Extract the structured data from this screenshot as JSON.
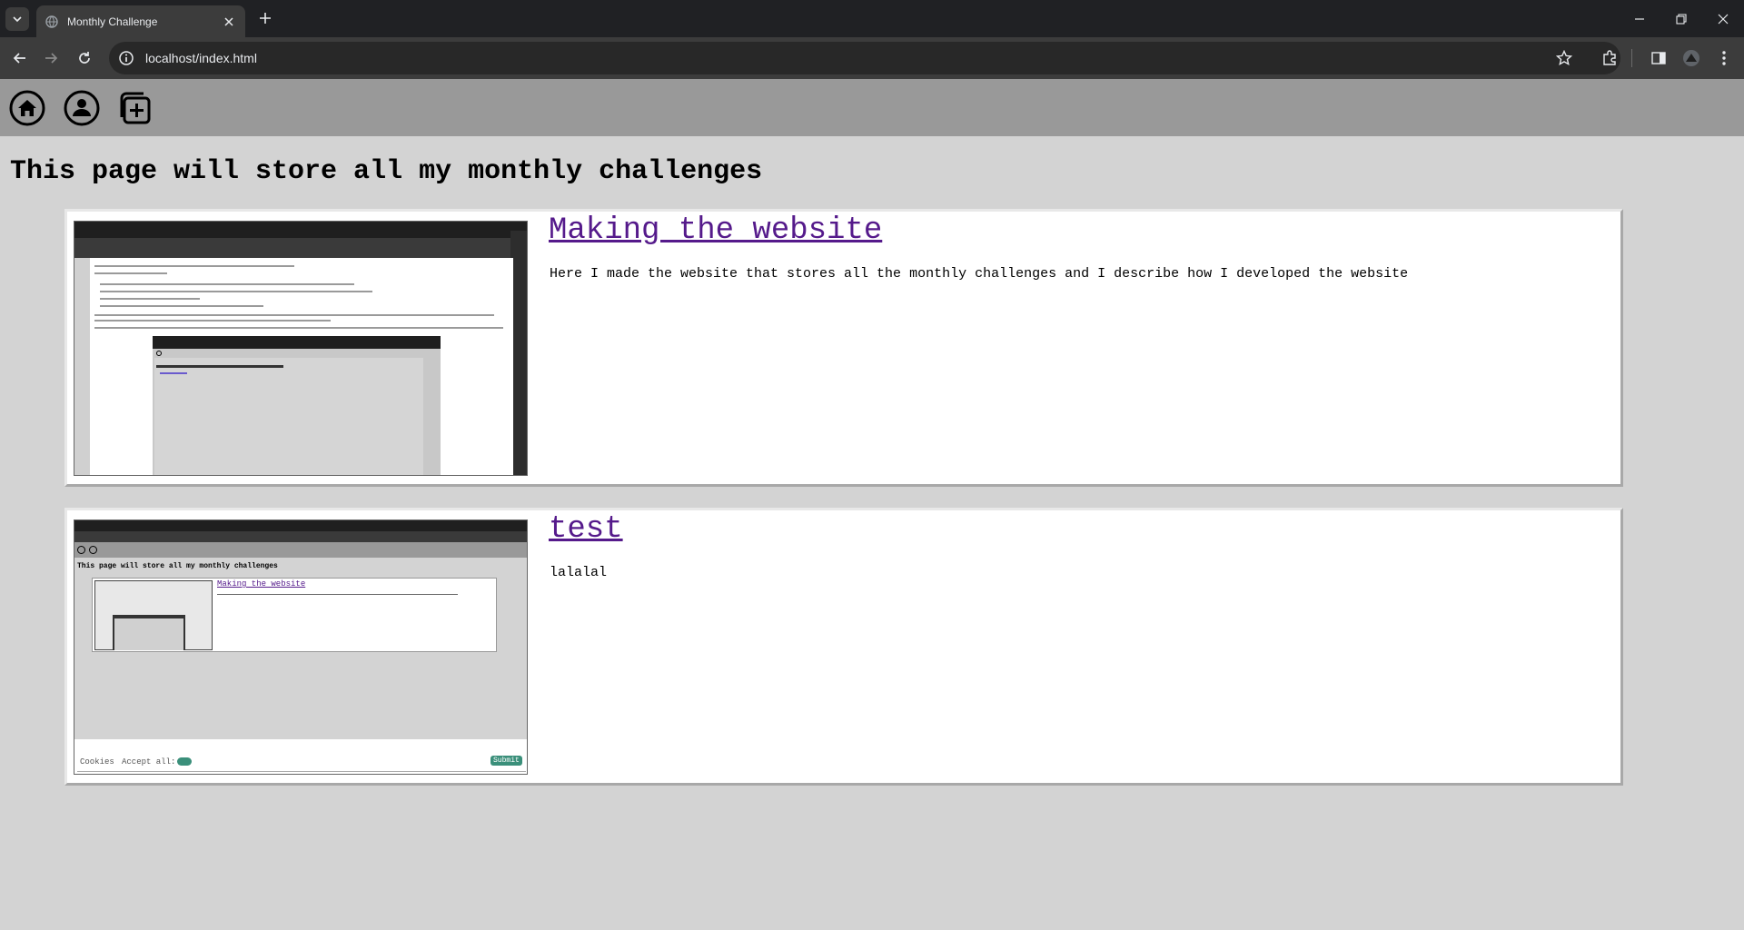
{
  "browser": {
    "tab_title": "Monthly Challenge",
    "url": "localhost/index.html"
  },
  "page": {
    "heading": "This page will store all my monthly challenges",
    "nav_icons": [
      "home-icon",
      "user-icon",
      "add-post-icon"
    ]
  },
  "challenges": [
    {
      "title": "Making the website",
      "description": "Here I made the website that stores all the monthly challenges and I describe how I developed the website"
    },
    {
      "title": "test",
      "description": "lalalal"
    }
  ],
  "thumbnails": {
    "second": {
      "heading": "This page will store all my monthly challenges",
      "inner_card_title": "Making the website",
      "cookies_label": "Cookies",
      "accept_label": "Accept all:",
      "submit_label": "Submit"
    }
  }
}
